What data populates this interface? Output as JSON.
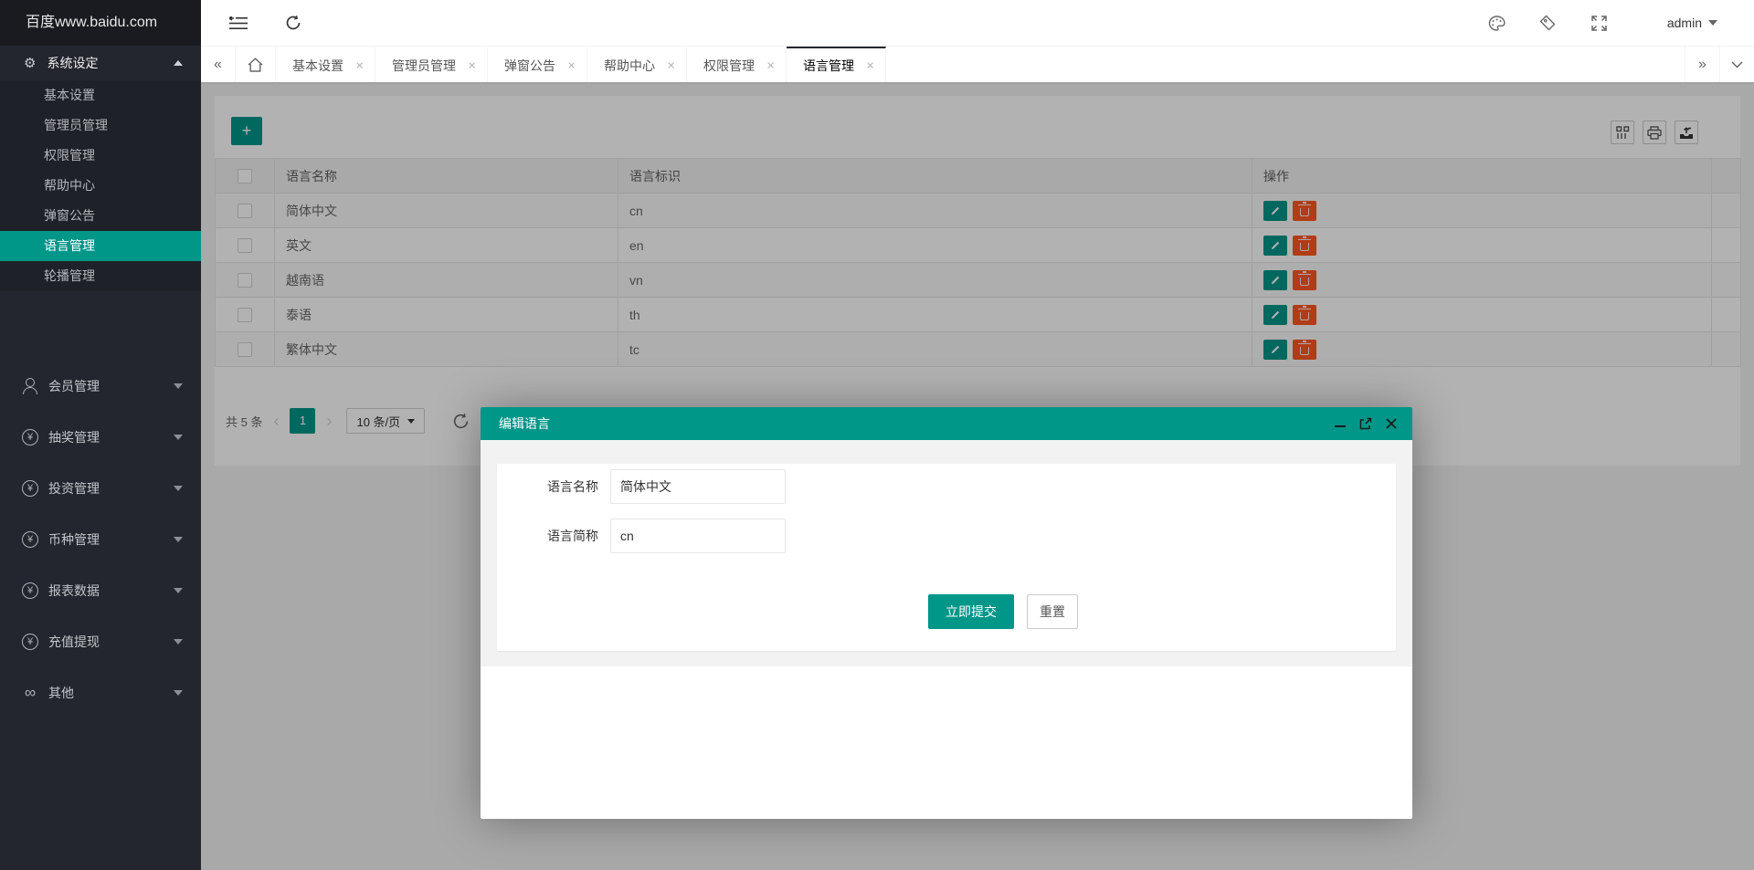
{
  "colors": {
    "accent": "#009688",
    "danger": "#FF5722",
    "sidebar_bg": "#23262E"
  },
  "logo": {
    "title": "百度www.baidu.com"
  },
  "header": {
    "user": "admin",
    "icons": [
      "collapse-sidebar",
      "refresh",
      "theme-palette",
      "tag",
      "fullscreen"
    ]
  },
  "sidebar": {
    "group_open": {
      "label": "系统设定",
      "icon": "gear",
      "gear_glyph": "⚙"
    },
    "submenu": [
      {
        "label": "基本设置",
        "active": false
      },
      {
        "label": "管理员管理",
        "active": false
      },
      {
        "label": "权限管理",
        "active": false
      },
      {
        "label": "帮助中心",
        "active": false
      },
      {
        "label": "弹窗公告",
        "active": false
      },
      {
        "label": "语言管理",
        "active": true
      },
      {
        "label": "轮播管理",
        "active": false
      }
    ],
    "groups": [
      {
        "label": "会员管理",
        "icon": "user"
      },
      {
        "label": "抽奖管理",
        "icon": "yen",
        "glyph": "¥"
      },
      {
        "label": "投资管理",
        "icon": "yen",
        "glyph": "¥"
      },
      {
        "label": "币种管理",
        "icon": "yen",
        "glyph": "¥"
      },
      {
        "label": "报表数据",
        "icon": "yen",
        "glyph": "¥"
      },
      {
        "label": "充值提现",
        "icon": "yen",
        "glyph": "¥"
      },
      {
        "label": "其他",
        "icon": "inf",
        "glyph": "∞"
      }
    ]
  },
  "tabs": {
    "back_glyph": "«",
    "forward_glyph": "»",
    "close_glyph": "×",
    "items": [
      {
        "label": "基本设置",
        "active": false
      },
      {
        "label": "管理员管理",
        "active": false
      },
      {
        "label": "弹窗公告",
        "active": false
      },
      {
        "label": "帮助中心",
        "active": false
      },
      {
        "label": "权限管理",
        "active": false
      },
      {
        "label": "语言管理",
        "active": true
      }
    ]
  },
  "toolbar": {
    "add_label": "+",
    "icons": [
      "filter-columns",
      "print",
      "export"
    ]
  },
  "table": {
    "headers": {
      "name": "语言名称",
      "code": "语言标识",
      "action": "操作"
    },
    "rows": [
      {
        "name": "简体中文",
        "code": "cn"
      },
      {
        "name": "英文",
        "code": "en"
      },
      {
        "name": "越南语",
        "code": "vn"
      },
      {
        "name": "泰语",
        "code": "th"
      },
      {
        "name": "繁体中文",
        "code": "tc"
      }
    ]
  },
  "pagination": {
    "total": "共 5 条",
    "prev_glyph": "‹",
    "next_glyph": "›",
    "current_page": "1",
    "page_size": "10 条/页"
  },
  "modal": {
    "title": "编辑语言",
    "fields": [
      {
        "label": "语言名称",
        "value": "简体中文"
      },
      {
        "label": "语言简称",
        "value": "cn"
      }
    ],
    "submit_label": "立即提交",
    "reset_label": "重置"
  }
}
